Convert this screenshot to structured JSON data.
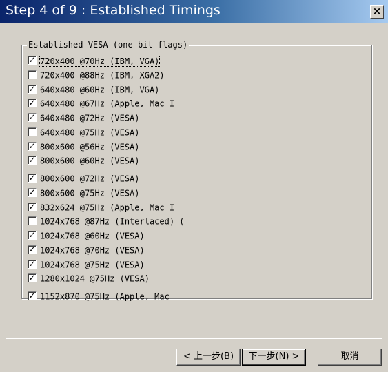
{
  "window": {
    "title": "Step 4 of 9 : Established Timings",
    "close_label": "×"
  },
  "group": {
    "legend": "Established VESA (one-bit flags)"
  },
  "checkboxes": [
    {
      "label": "720x400 @70Hz (IBM, VGA)",
      "checked": true,
      "focused": true
    },
    {
      "label": "720x400 @88Hz (IBM, XGA2)",
      "checked": false
    },
    {
      "label": "640x480 @60Hz (IBM, VGA)",
      "checked": true
    },
    {
      "label": "640x480 @67Hz (Apple, Mac I",
      "checked": true
    },
    {
      "label": "640x480 @72Hz (VESA)",
      "checked": true
    },
    {
      "label": "640x480 @75Hz (VESA)",
      "checked": false
    },
    {
      "label": "800x600 @56Hz (VESA)",
      "checked": true
    },
    {
      "label": "800x600 @60Hz (VESA)",
      "checked": true
    },
    {
      "label": "800x600 @72Hz (VESA)",
      "checked": true
    },
    {
      "label": "800x600 @75Hz (VESA)",
      "checked": true
    },
    {
      "label": "832x624 @75Hz (Apple, Mac I",
      "checked": true
    },
    {
      "label": "1024x768 @87Hz (Interlaced) (",
      "checked": false
    },
    {
      "label": "1024x768 @60Hz (VESA)",
      "checked": true
    },
    {
      "label": "1024x768 @70Hz (VESA)",
      "checked": true
    },
    {
      "label": "1024x768 @75Hz (VESA)",
      "checked": true
    },
    {
      "label": "1280x1024 @75Hz (VESA)",
      "checked": true
    },
    {
      "label": "1152x870 @75Hz (Apple, Mac",
      "checked": true
    }
  ],
  "buttons": {
    "back": "< 上一步(B)",
    "next": "下一步(N) >",
    "cancel": "取消"
  },
  "colors": {
    "title_gradient_start": "#0a246a",
    "title_gradient_end": "#a6caf0",
    "dialog_face": "#d4d0c8"
  }
}
